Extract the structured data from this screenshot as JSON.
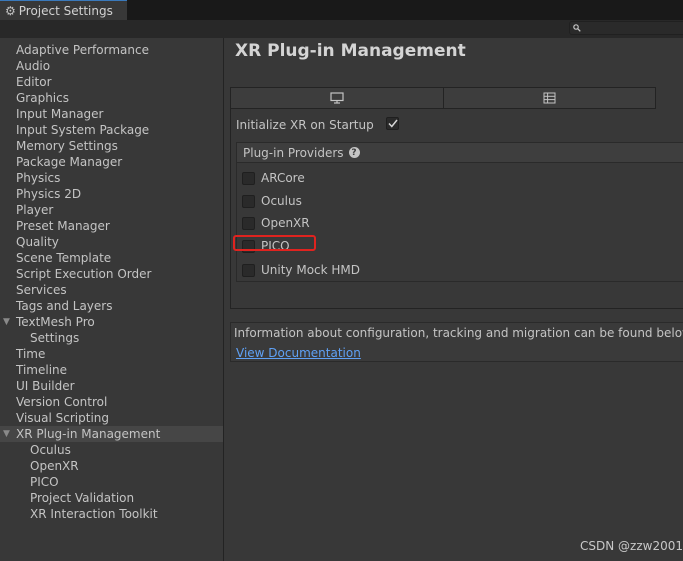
{
  "window": {
    "tab_title": "Project Settings",
    "tab_icon": "gear-icon"
  },
  "search": {
    "icon": "search-icon",
    "value": ""
  },
  "sidebar": {
    "items": [
      {
        "label": "Adaptive Performance"
      },
      {
        "label": "Audio"
      },
      {
        "label": "Editor"
      },
      {
        "label": "Graphics"
      },
      {
        "label": "Input Manager"
      },
      {
        "label": "Input System Package"
      },
      {
        "label": "Memory Settings"
      },
      {
        "label": "Package Manager"
      },
      {
        "label": "Physics"
      },
      {
        "label": "Physics 2D"
      },
      {
        "label": "Player"
      },
      {
        "label": "Preset Manager"
      },
      {
        "label": "Quality"
      },
      {
        "label": "Scene Template"
      },
      {
        "label": "Script Execution Order"
      },
      {
        "label": "Services"
      },
      {
        "label": "Tags and Layers"
      },
      {
        "label": "TextMesh Pro",
        "expanded": true
      },
      {
        "label": "Settings",
        "child": true
      },
      {
        "label": "Time"
      },
      {
        "label": "Timeline"
      },
      {
        "label": "UI Builder"
      },
      {
        "label": "Version Control"
      },
      {
        "label": "Visual Scripting"
      },
      {
        "label": "XR Plug-in Management",
        "expanded": true,
        "selected": true
      },
      {
        "label": "Oculus",
        "child": true
      },
      {
        "label": "OpenXR",
        "child": true
      },
      {
        "label": "PICO",
        "child": true
      },
      {
        "label": "Project Validation",
        "child": true
      },
      {
        "label": "XR Interaction Toolkit",
        "child": true
      }
    ]
  },
  "main": {
    "title": "XR Plug-in Management",
    "platform_tabs": [
      {
        "icon": "monitor-icon",
        "active": false
      },
      {
        "icon": "android-grid-icon",
        "active": false
      }
    ],
    "initialize_label": "Initialize XR on Startup",
    "initialize_checked": true,
    "providers_header": "Plug-in Providers",
    "providers": [
      {
        "label": "ARCore",
        "checked": false
      },
      {
        "label": "Oculus",
        "checked": false
      },
      {
        "label": "OpenXR",
        "checked": false
      },
      {
        "label": "PICO",
        "checked": false,
        "highlighted": true
      },
      {
        "label": "Unity Mock HMD",
        "checked": false
      }
    ],
    "info_text": "Information about configuration, tracking and migration can be found below.",
    "info_link": "View Documentation"
  },
  "colors": {
    "highlight": "#e0231f",
    "link": "#5fa1f5",
    "selected_row": "#464646"
  },
  "watermark": "CSDN @zzw2001"
}
